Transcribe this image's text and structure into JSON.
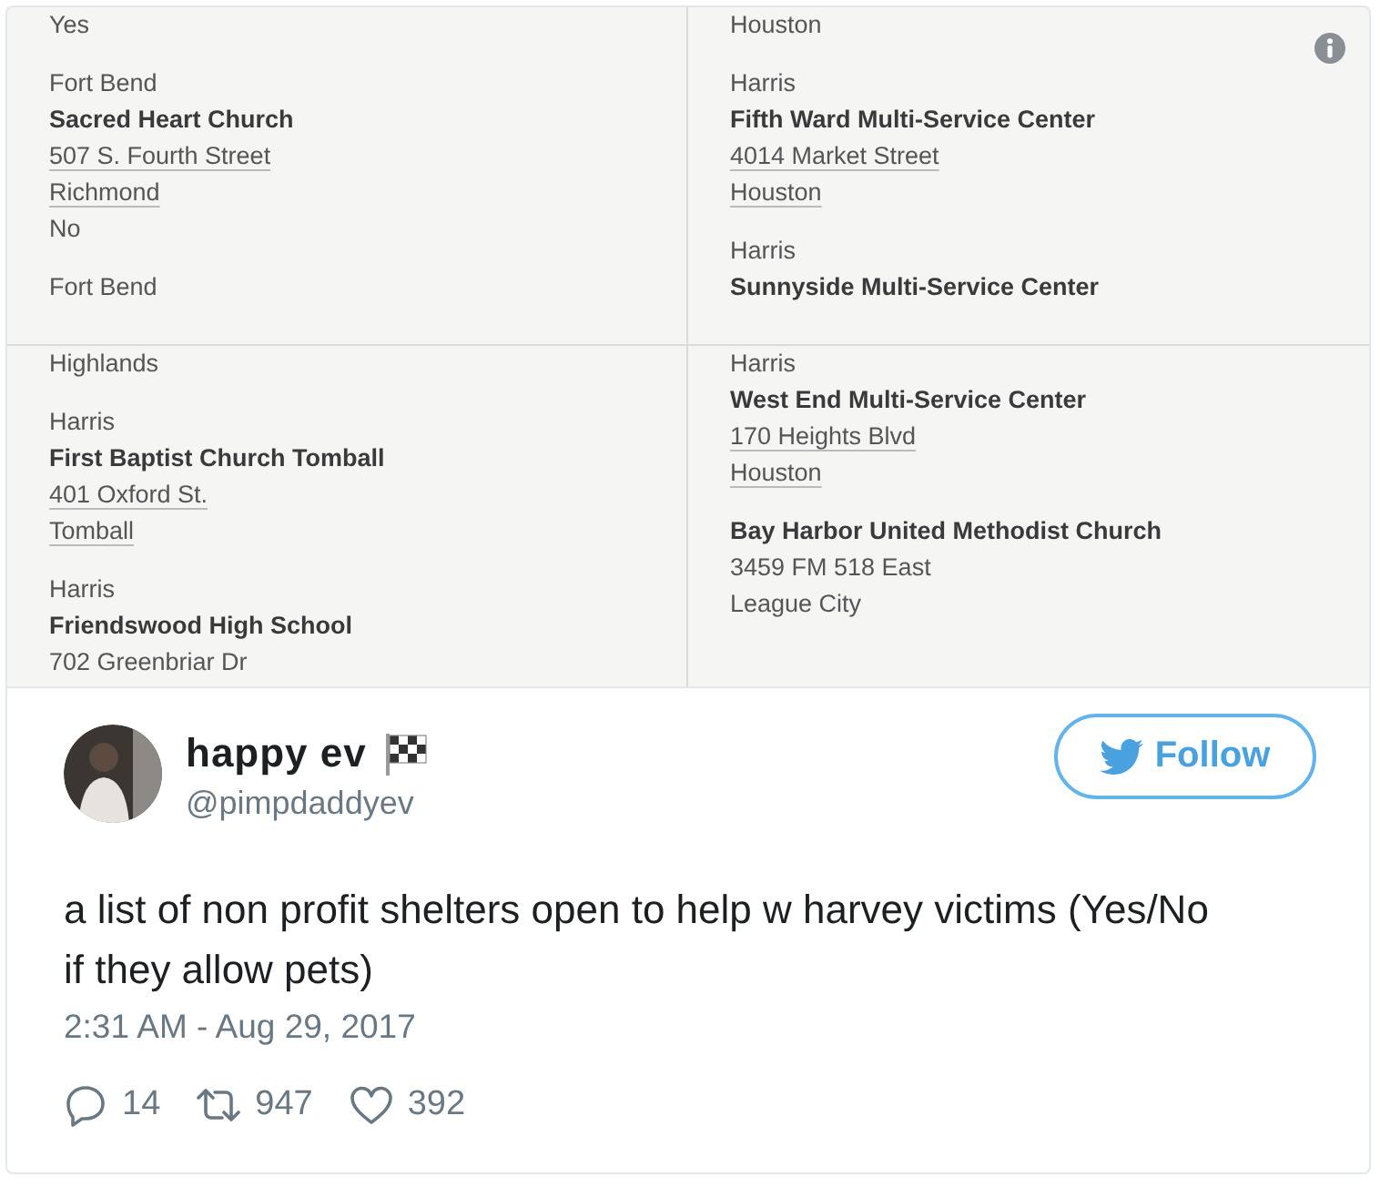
{
  "photo": {
    "panels": [
      {
        "entries": [
          [
            {
              "kind": "plain",
              "text": "Yes"
            }
          ],
          [
            {
              "kind": "plain",
              "text": "Fort Bend"
            },
            {
              "kind": "bold",
              "text": "Sacred Heart Church"
            },
            {
              "kind": "link",
              "text": "507 S. Fourth Street"
            },
            {
              "kind": "link",
              "text": "Richmond"
            },
            {
              "kind": "plain",
              "text": "No"
            }
          ],
          [
            {
              "kind": "plain",
              "text": "Fort Bend"
            }
          ]
        ]
      },
      {
        "entries": [
          [
            {
              "kind": "plain",
              "text": "Houston"
            }
          ],
          [
            {
              "kind": "plain",
              "text": "Harris"
            },
            {
              "kind": "bold",
              "text": "Fifth Ward Multi-Service Center"
            },
            {
              "kind": "link",
              "text": "4014 Market Street"
            },
            {
              "kind": "link",
              "text": "Houston"
            }
          ],
          [
            {
              "kind": "plain",
              "text": "Harris"
            },
            {
              "kind": "bold",
              "text": "Sunnyside Multi-Service Center"
            }
          ]
        ]
      },
      {
        "entries": [
          [
            {
              "kind": "plain",
              "text": "Highlands"
            }
          ],
          [
            {
              "kind": "plain",
              "text": "Harris"
            },
            {
              "kind": "bold",
              "text": "First Baptist Church Tomball"
            },
            {
              "kind": "link",
              "text": "401 Oxford St."
            },
            {
              "kind": "link",
              "text": "Tomball"
            }
          ],
          [
            {
              "kind": "plain",
              "text": "Harris"
            },
            {
              "kind": "bold",
              "text": "Friendswood High School"
            },
            {
              "kind": "plain",
              "text": "702 Greenbriar Dr"
            }
          ]
        ]
      },
      {
        "entries": [
          [
            {
              "kind": "plain",
              "text": "Harris"
            },
            {
              "kind": "bold",
              "text": "West End Multi-Service Center"
            },
            {
              "kind": "link",
              "text": "170 Heights Blvd"
            },
            {
              "kind": "link",
              "text": "Houston"
            }
          ],
          [
            {
              "kind": "bold",
              "text": "Bay Harbor United Methodist Church"
            },
            {
              "kind": "plain",
              "text": "3459 FM 518 East"
            },
            {
              "kind": "plain",
              "text": "League City"
            }
          ]
        ]
      }
    ]
  },
  "tweet": {
    "name": "happy ev",
    "handle": "@pimpdaddyev",
    "follow_label": "Follow",
    "text": "a list of non profit shelters open to help w harvey victims (Yes/No if they allow pets)",
    "time": "2:31 AM - Aug 29, 2017",
    "replies": "14",
    "retweets": "947",
    "likes": "392"
  }
}
